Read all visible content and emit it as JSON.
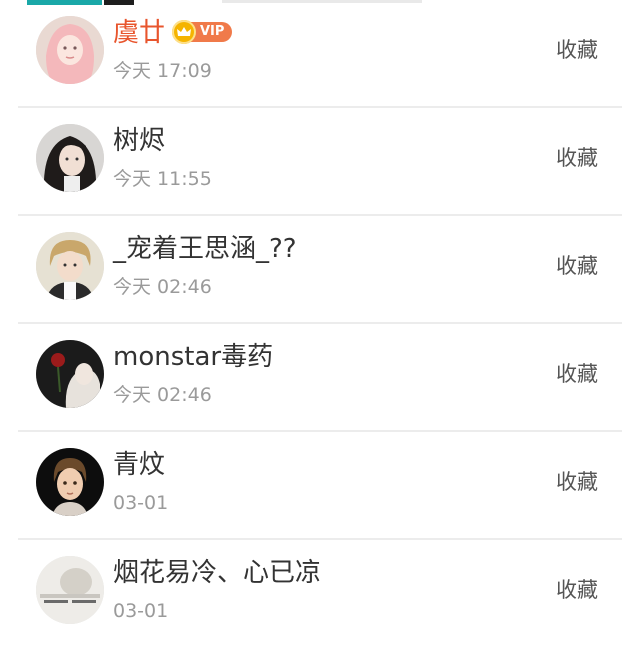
{
  "colors": {
    "vip_name": "#e8552d",
    "vip_tag": "#f07a4a",
    "crown": "#f5b400",
    "text": "#333333",
    "muted": "#9a9a9a"
  },
  "vip_badge": {
    "icon": "crown-icon",
    "label": "VIP"
  },
  "users": [
    {
      "name": "虞廿",
      "time": "今天 17:09",
      "action": "收藏",
      "vip": true,
      "avatar": "avatar-pink-hair"
    },
    {
      "name": "树烬",
      "time": "今天 11:55",
      "action": "收藏",
      "vip": false,
      "avatar": "avatar-dark-hair-girl"
    },
    {
      "name": "_宠着王思涵_??",
      "time": "今天 02:46",
      "action": "收藏",
      "vip": false,
      "avatar": "avatar-boy-blond"
    },
    {
      "name": "monstar毒药",
      "time": "今天 02:46",
      "action": "收藏",
      "vip": false,
      "avatar": "avatar-dark-rose"
    },
    {
      "name": "青炆",
      "time": "03-01",
      "action": "收藏",
      "vip": false,
      "avatar": "avatar-cartoon-boy"
    },
    {
      "name": "烟花易冷、心已凉",
      "time": "03-01",
      "action": "收藏",
      "vip": false,
      "avatar": "avatar-text-image"
    }
  ]
}
